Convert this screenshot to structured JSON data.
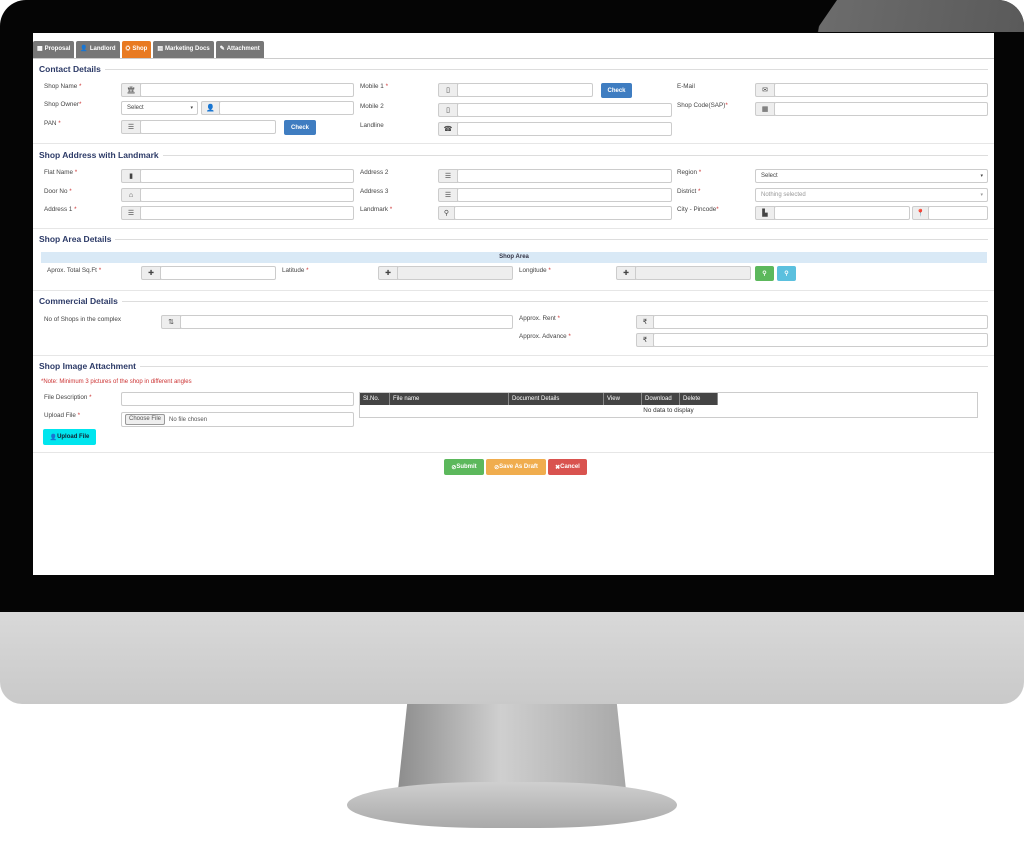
{
  "tabs": [
    {
      "label": "Proposal",
      "icon": "table-icon"
    },
    {
      "label": "Landlord",
      "icon": "user-icon"
    },
    {
      "label": "Shop",
      "icon": "shop-icon"
    },
    {
      "label": "Marketing Docs",
      "icon": "document-icon"
    },
    {
      "label": "Attachment",
      "icon": "paperclip-icon"
    }
  ],
  "active_tab": "Shop",
  "contact": {
    "title": "Contact Details",
    "shop_name": "Shop Name ",
    "shop_owner": "Shop Owner",
    "owner_select": "Select",
    "pan": "PAN ",
    "mobile1": "Mobile 1 ",
    "mobile2": "Mobile 2",
    "landline": "Landline",
    "email": "E-Mail",
    "shop_code": "Shop Code(SAP)",
    "check": "Check"
  },
  "address": {
    "title": "Shop Address with Landmark",
    "flat": "Flat Name ",
    "door": "Door No ",
    "addr1": "Address 1 ",
    "addr2": "Address 2",
    "addr3": "Address 3",
    "landmark": "Landmark ",
    "region": "Region ",
    "region_select": "Select",
    "district": "District ",
    "district_select": "Nothing selected",
    "city": "City - Pincode"
  },
  "area": {
    "title": "Shop Area Details",
    "band": "Shop Area",
    "sqft": "Aprox. Total Sq.Ft ",
    "latitude": "Latitude ",
    "longitude": "Longitude "
  },
  "commercial": {
    "title": "Commercial Details",
    "shops": "No of Shops in the complex",
    "rent": "Approx. Rent ",
    "advance": "Approx. Advance "
  },
  "image": {
    "title": "Shop Image Attachment",
    "note": "*Note: Minimum 3 pictures of the shop in different angles",
    "file_desc": "File Description ",
    "upload_file": "Upload File ",
    "choose": "Choose File",
    "no_file": "No file chosen",
    "upload_btn": "Upload File",
    "columns": [
      "Sl.No.",
      "File name",
      "Document Details",
      "View",
      "Download",
      "Delete"
    ],
    "empty": "No data to display"
  },
  "actions": {
    "submit": "Submit",
    "draft": "Save As Draft",
    "cancel": "Cancel"
  },
  "colors": {
    "active_tab": "#e87a22",
    "submit": "#5cb85c",
    "draft": "#f0ad4e",
    "cancel": "#d9534f",
    "upload": "#00e5ee",
    "check": "#3f7dc1"
  }
}
